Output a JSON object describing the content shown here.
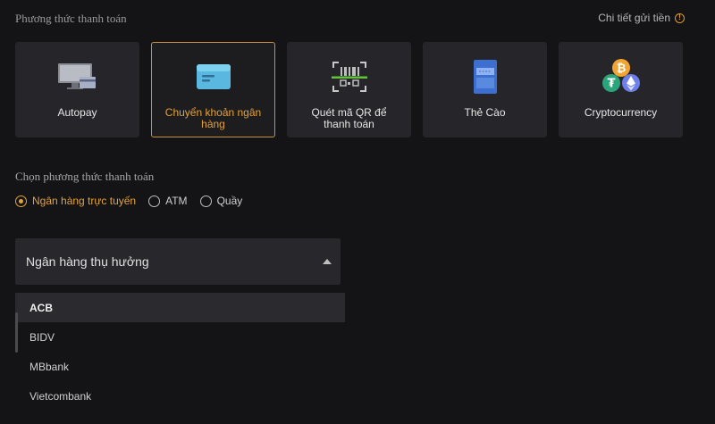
{
  "header": {
    "title": "Phương thức thanh toán",
    "deposit_details": "Chi tiết gửi tiền"
  },
  "methods": [
    {
      "label": "Autopay",
      "icon": "monitor-icon"
    },
    {
      "label": "Chuyển khoản ngân hàng",
      "icon": "card-icon"
    },
    {
      "label": "Quét mã QR để thanh toán",
      "icon": "qr-scan-icon"
    },
    {
      "label": "Thẻ Cào",
      "icon": "scratch-card-icon"
    },
    {
      "label": "Cryptocurrency",
      "icon": "crypto-coins-icon"
    }
  ],
  "payment_choice": {
    "title": "Chọn phương thức thanh toán",
    "options": [
      "Ngân hàng trực tuyến",
      "ATM",
      "Quầy"
    ],
    "selected": "Ngân hàng trực tuyến"
  },
  "beneficiary": {
    "label": "Ngân hàng thụ hưởng",
    "options": [
      "ACB",
      "BIDV",
      "MBbank",
      "Vietcombank"
    ],
    "highlighted": "ACB"
  },
  "colors": {
    "accent": "#e3a13a",
    "card_bg": "#25252a",
    "page_bg": "#141416"
  }
}
